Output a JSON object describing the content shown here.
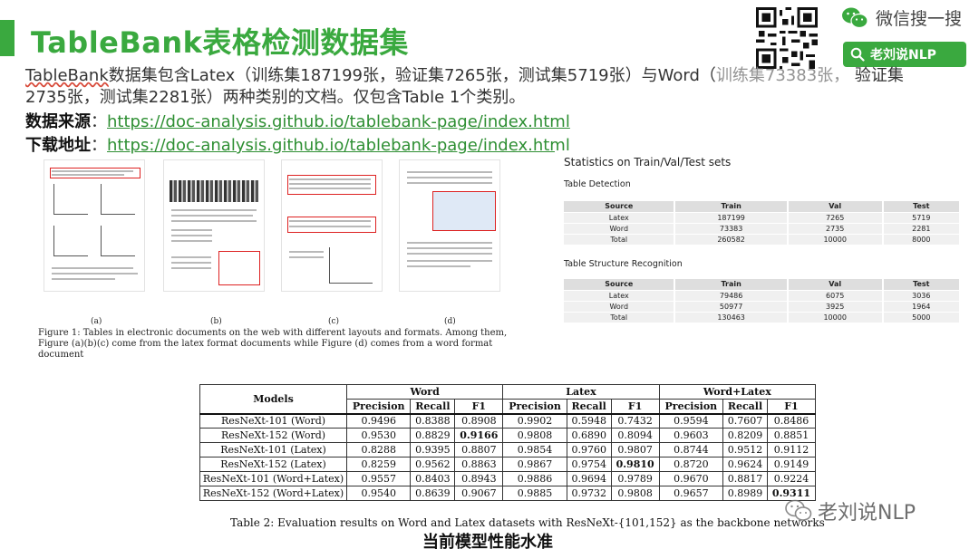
{
  "header": {
    "title": "TableBank表格检测数据集",
    "accent": "#3aa93f"
  },
  "brand": {
    "wechat_text": "微信搜一搜",
    "search_label": "老刘说NLP"
  },
  "intro": {
    "part1": "TableBank",
    "part2": "数据集包含Latex（训练集187199张，验证集7265张，测试集5719张）与Word（",
    "part3": "训练集73383张，",
    "part4": " 验证集2735张，测试集2281张）两种类别的文档。仅包含Table 1个类别。"
  },
  "source": {
    "label": "数据来源",
    "url": "https://doc-analysis.github.io/tablebank-page/index.html"
  },
  "download": {
    "label": "下载地址",
    "url": "https://doc-analysis.github.io/tablebank-page/index.html"
  },
  "figure1": {
    "subcaptions": [
      "(a)",
      "(b)",
      "(c)",
      "(d)"
    ],
    "caption": "Figure 1: Tables in electronic documents on the web with different layouts and formats. Among them, Figure (a)(b)(c) come from the latex format documents while Figure (d) comes from a word format document"
  },
  "stats": {
    "title": "Statistics on Train/Val/Test sets",
    "detection": {
      "title": "Table Detection",
      "columns": [
        "Source",
        "Train",
        "Val",
        "Test"
      ],
      "rows": [
        [
          "Latex",
          "187199",
          "7265",
          "5719"
        ],
        [
          "Word",
          "73383",
          "2735",
          "2281"
        ],
        [
          "Total",
          "260582",
          "10000",
          "8000"
        ]
      ]
    },
    "structure": {
      "title": "Table Structure Recognition",
      "columns": [
        "Source",
        "Train",
        "Val",
        "Test"
      ],
      "rows": [
        [
          "Latex",
          "79486",
          "6075",
          "3036"
        ],
        [
          "Word",
          "50977",
          "3925",
          "1964"
        ],
        [
          "Total",
          "130463",
          "10000",
          "5000"
        ]
      ]
    }
  },
  "eval": {
    "models_header": "Models",
    "groups": [
      "Word",
      "Latex",
      "Word+Latex"
    ],
    "metrics": [
      "Precision",
      "Recall",
      "F1"
    ],
    "rows": [
      {
        "model": "ResNeXt-101 (Word)",
        "values": [
          "0.9496",
          "0.8388",
          "0.8908",
          "0.9902",
          "0.5948",
          "0.7432",
          "0.9594",
          "0.7607",
          "0.8486"
        ]
      },
      {
        "model": "ResNeXt-152 (Word)",
        "values": [
          "0.9530",
          "0.8829",
          "0.9166",
          "0.9808",
          "0.6890",
          "0.8094",
          "0.9603",
          "0.8209",
          "0.8851"
        ]
      },
      {
        "model": "ResNeXt-101 (Latex)",
        "values": [
          "0.8288",
          "0.9395",
          "0.8807",
          "0.9854",
          "0.9760",
          "0.9807",
          "0.8744",
          "0.9512",
          "0.9112"
        ]
      },
      {
        "model": "ResNeXt-152 (Latex)",
        "values": [
          "0.8259",
          "0.9562",
          "0.8863",
          "0.9867",
          "0.9754",
          "0.9810",
          "0.8720",
          "0.9624",
          "0.9149"
        ]
      },
      {
        "model": "ResNeXt-101 (Word+Latex)",
        "values": [
          "0.9557",
          "0.8403",
          "0.8943",
          "0.9886",
          "0.9694",
          "0.9789",
          "0.9670",
          "0.8817",
          "0.9224"
        ]
      },
      {
        "model": "ResNeXt-152 (Word+Latex)",
        "values": [
          "0.9540",
          "0.8639",
          "0.9067",
          "0.9885",
          "0.9732",
          "0.9808",
          "0.9657",
          "0.8989",
          "0.9311"
        ]
      }
    ],
    "caption": "Table 2: Evaluation results on Word and Latex datasets with ResNeXt-{101,152} as the backbone networks"
  },
  "footer": {
    "model_performance": "当前模型性能水准",
    "watermark": "老刘说NLP"
  }
}
